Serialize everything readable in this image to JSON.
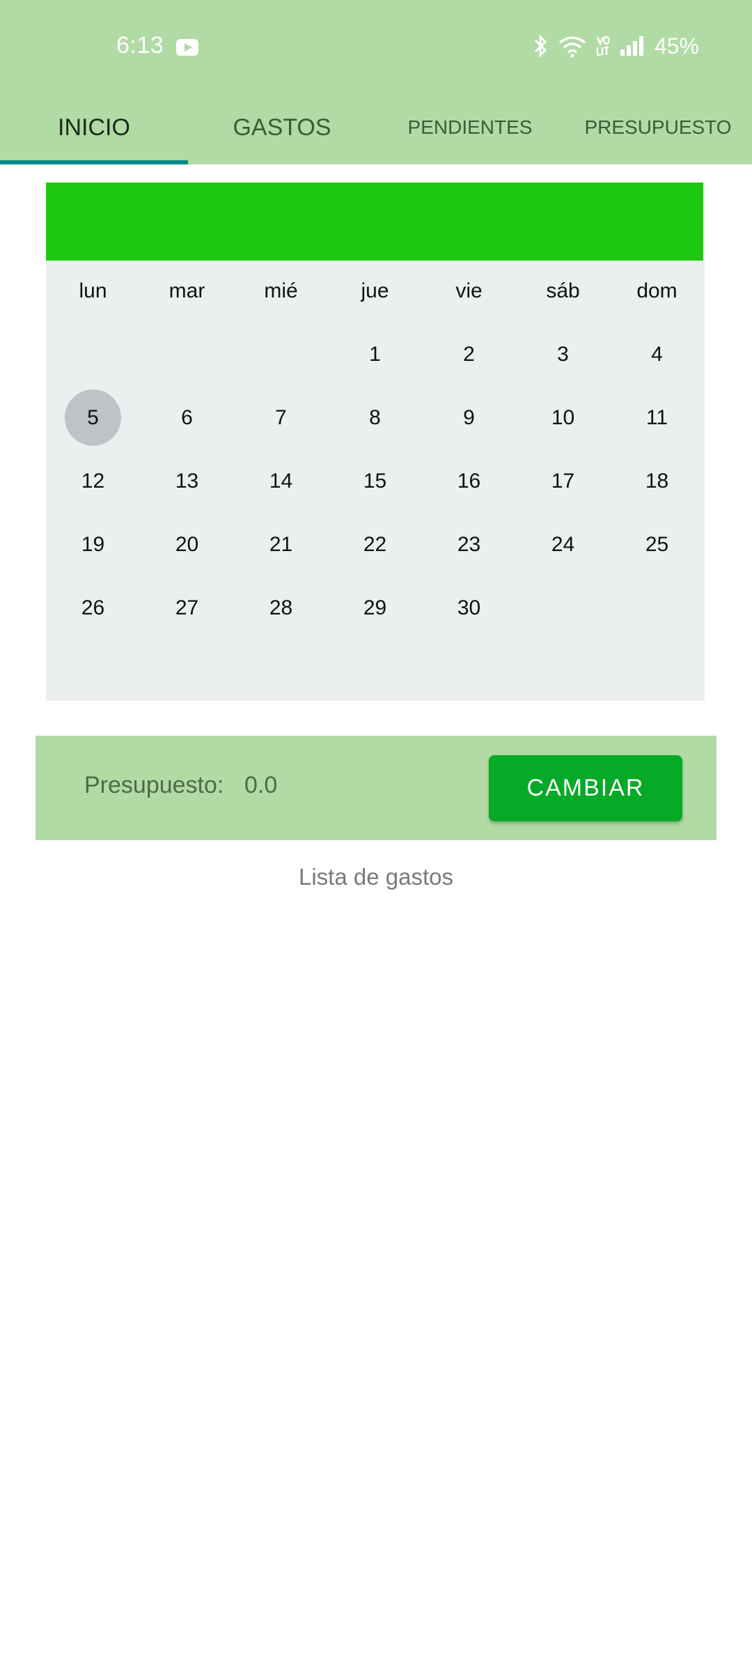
{
  "status_bar": {
    "time": "6:13",
    "battery": "45%",
    "icons": [
      "youtube-icon",
      "bluetooth-icon",
      "wifi-icon",
      "volte-icon",
      "signal-icon"
    ]
  },
  "tabs": [
    {
      "label": "INICIO",
      "active": true
    },
    {
      "label": "GASTOS",
      "active": false
    },
    {
      "label": "PENDIENTES",
      "active": false
    },
    {
      "label": "PRESUPUESTO",
      "active": false
    }
  ],
  "calendar": {
    "weekdays": [
      "lun",
      "mar",
      "mié",
      "jue",
      "vie",
      "sáb",
      "dom"
    ],
    "weeks": [
      [
        "",
        "",
        "",
        "1",
        "2",
        "3",
        "4"
      ],
      [
        "5",
        "6",
        "7",
        "8",
        "9",
        "10",
        "11"
      ],
      [
        "12",
        "13",
        "14",
        "15",
        "16",
        "17",
        "18"
      ],
      [
        "19",
        "20",
        "21",
        "22",
        "23",
        "24",
        "25"
      ],
      [
        "26",
        "27",
        "28",
        "29",
        "30",
        "",
        ""
      ]
    ],
    "selected_day": "5"
  },
  "budget": {
    "label": "Presupuesto:",
    "value": "0.0",
    "button_label": "CAMBIAR"
  },
  "expenses": {
    "title": "Lista de gastos"
  },
  "colors": {
    "header": "#b2daa5",
    "calendar_header": "#1ec90f",
    "button": "#06aa27",
    "tab_indicator": "#0a8a8a"
  }
}
